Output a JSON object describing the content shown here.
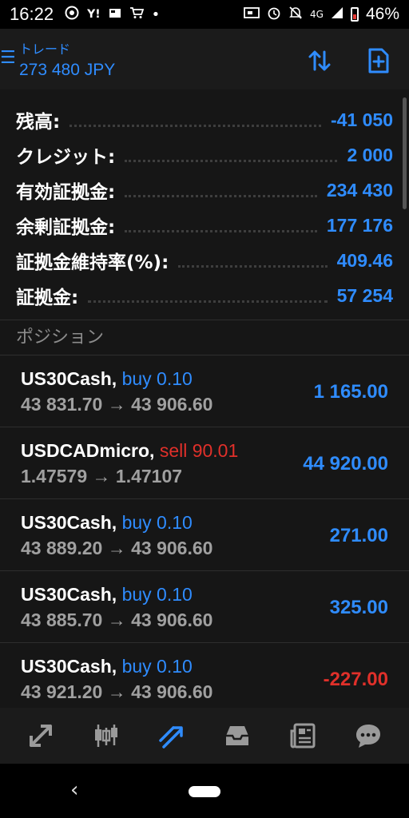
{
  "status_bar": {
    "time": "16:22",
    "network": "4G",
    "battery": "46%",
    "left_icons": [
      "chrome-icon",
      "yahoo-icon",
      "news-icon",
      "cart-icon",
      "dot-icon"
    ],
    "right_icons": [
      "cast-icon",
      "alarm-icon",
      "mute-icon",
      "signal-icon",
      "battery-icon"
    ]
  },
  "header": {
    "title": "トレード",
    "balance": "273 480 JPY"
  },
  "summary": [
    {
      "label": "残高:",
      "value": "-41 050"
    },
    {
      "label": "クレジット:",
      "value": "2 000"
    },
    {
      "label": "有効証拠金:",
      "value": "234 430"
    },
    {
      "label": "余剰証拠金:",
      "value": "177 176"
    },
    {
      "label": "証拠金維持率(%):",
      "value": "409.46"
    },
    {
      "label": "証拠金:",
      "value": "57 254"
    }
  ],
  "positions_title": "ポジション",
  "positions": [
    {
      "symbol": "US30Cash,",
      "side": "buy 0.10",
      "side_type": "buy",
      "prices": "43 831.70 → 43 906.60",
      "profit": "1 165.00",
      "sign": "pos"
    },
    {
      "symbol": "USDCADmicro,",
      "side": "sell 90.01",
      "side_type": "sell",
      "prices": "1.47579 → 1.47107",
      "profit": "44 920.00",
      "sign": "pos"
    },
    {
      "symbol": "US30Cash,",
      "side": "buy 0.10",
      "side_type": "buy",
      "prices": "43 889.20 → 43 906.60",
      "profit": "271.00",
      "sign": "pos"
    },
    {
      "symbol": "US30Cash,",
      "side": "buy 0.10",
      "side_type": "buy",
      "prices": "43 885.70 → 43 906.60",
      "profit": "325.00",
      "sign": "pos"
    },
    {
      "symbol": "US30Cash,",
      "side": "buy 0.10",
      "side_type": "buy",
      "prices": "43 921.20 → 43 906.60",
      "profit": "-227.00",
      "sign": "neg"
    }
  ],
  "toolbar": {
    "items": [
      "quotes-icon",
      "chart-icon",
      "trade-icon",
      "history-icon",
      "news-icon",
      "chat-icon"
    ],
    "active": "trade-icon"
  },
  "colors": {
    "accent": "#2f8cff",
    "negative": "#e0302a",
    "background": "#161616",
    "header": "#1b1b1b"
  }
}
